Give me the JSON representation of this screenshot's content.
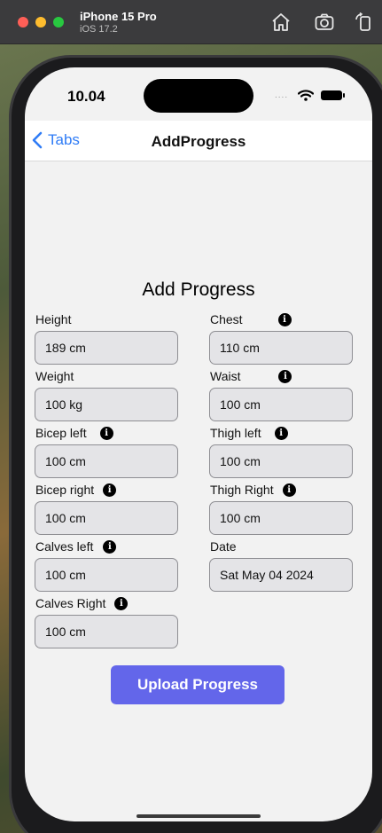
{
  "simulator": {
    "device": "iPhone 15 Pro",
    "os": "iOS 17.2"
  },
  "status_bar": {
    "time": "10.04",
    "dots": "...."
  },
  "nav": {
    "back_label": "Tabs",
    "title": "AddProgress"
  },
  "form": {
    "heading": "Add Progress",
    "height": {
      "label": "Height",
      "value": "189 cm"
    },
    "weight": {
      "label": "Weight",
      "value": "100 kg"
    },
    "bicep_left": {
      "label": "Bicep left",
      "value": "100 cm"
    },
    "bicep_right": {
      "label": "Bicep right",
      "value": "100 cm"
    },
    "calves_left": {
      "label": "Calves left",
      "value": "100 cm"
    },
    "calves_right": {
      "label": "Calves Right",
      "value": "100 cm"
    },
    "chest": {
      "label": "Chest",
      "value": "110 cm"
    },
    "waist": {
      "label": "Waist",
      "value": "100 cm"
    },
    "thigh_left": {
      "label": "Thigh left",
      "value": "100 cm"
    },
    "thigh_right": {
      "label": "Thigh Right",
      "value": "100 cm"
    },
    "date": {
      "label": "Date",
      "value": "Sat May 04 2024"
    },
    "info_glyph": "i",
    "submit_label": "Upload Progress"
  },
  "colors": {
    "accent": "#2f7cf6",
    "button": "#6366ea",
    "field_bg": "#e4e4e7"
  }
}
